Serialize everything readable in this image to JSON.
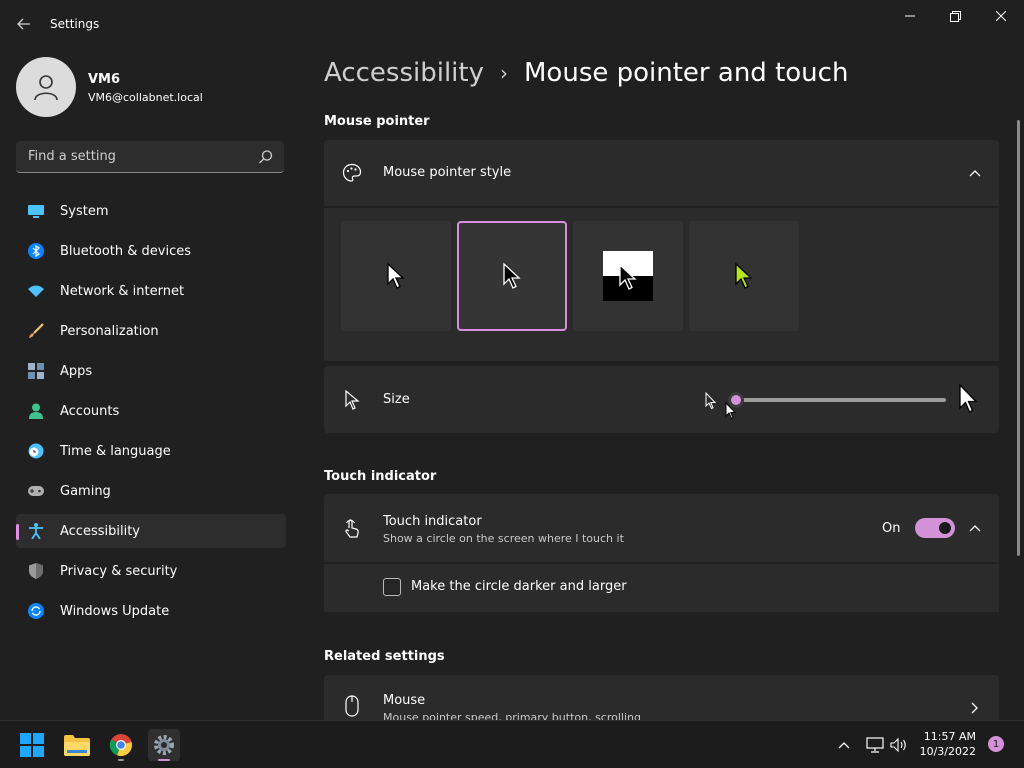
{
  "window": {
    "title": "Settings"
  },
  "user": {
    "name": "VM6",
    "email": "VM6@collabnet.local"
  },
  "search": {
    "placeholder": "Find a setting"
  },
  "sidebar": {
    "items": [
      {
        "label": "System",
        "icon": "monitor-icon"
      },
      {
        "label": "Bluetooth & devices",
        "icon": "bluetooth-icon"
      },
      {
        "label": "Network & internet",
        "icon": "wifi-icon"
      },
      {
        "label": "Personalization",
        "icon": "brush-icon"
      },
      {
        "label": "Apps",
        "icon": "apps-icon"
      },
      {
        "label": "Accounts",
        "icon": "person-icon"
      },
      {
        "label": "Time & language",
        "icon": "clock-globe-icon"
      },
      {
        "label": "Gaming",
        "icon": "gamepad-icon"
      },
      {
        "label": "Accessibility",
        "icon": "accessibility-icon",
        "active": true
      },
      {
        "label": "Privacy & security",
        "icon": "shield-icon"
      },
      {
        "label": "Windows Update",
        "icon": "update-icon"
      }
    ]
  },
  "breadcrumb": {
    "parent": "Accessibility",
    "separator": "›",
    "current": "Mouse pointer and touch"
  },
  "mouse_pointer": {
    "section_title": "Mouse pointer",
    "style_label": "Mouse pointer style",
    "styles": [
      "white",
      "black",
      "inverted",
      "custom"
    ],
    "selected_style": 1,
    "custom_color": "#b5e61d",
    "size_label": "Size",
    "size_value": 0.0
  },
  "touch_indicator": {
    "section_title": "Touch indicator",
    "title": "Touch indicator",
    "description": "Show a circle on the screen where I touch it",
    "state": "On",
    "option_label": "Make the circle darker and larger"
  },
  "related": {
    "section_title": "Related settings",
    "mouse_title": "Mouse",
    "mouse_desc": "Mouse pointer speed, primary button, scrolling"
  },
  "taskbar": {
    "time": "11:57 AM",
    "date": "10/3/2022",
    "notifications": "1"
  },
  "colors": {
    "accent": "#d391d8",
    "background": "#202020",
    "card": "#2b2b2b"
  }
}
